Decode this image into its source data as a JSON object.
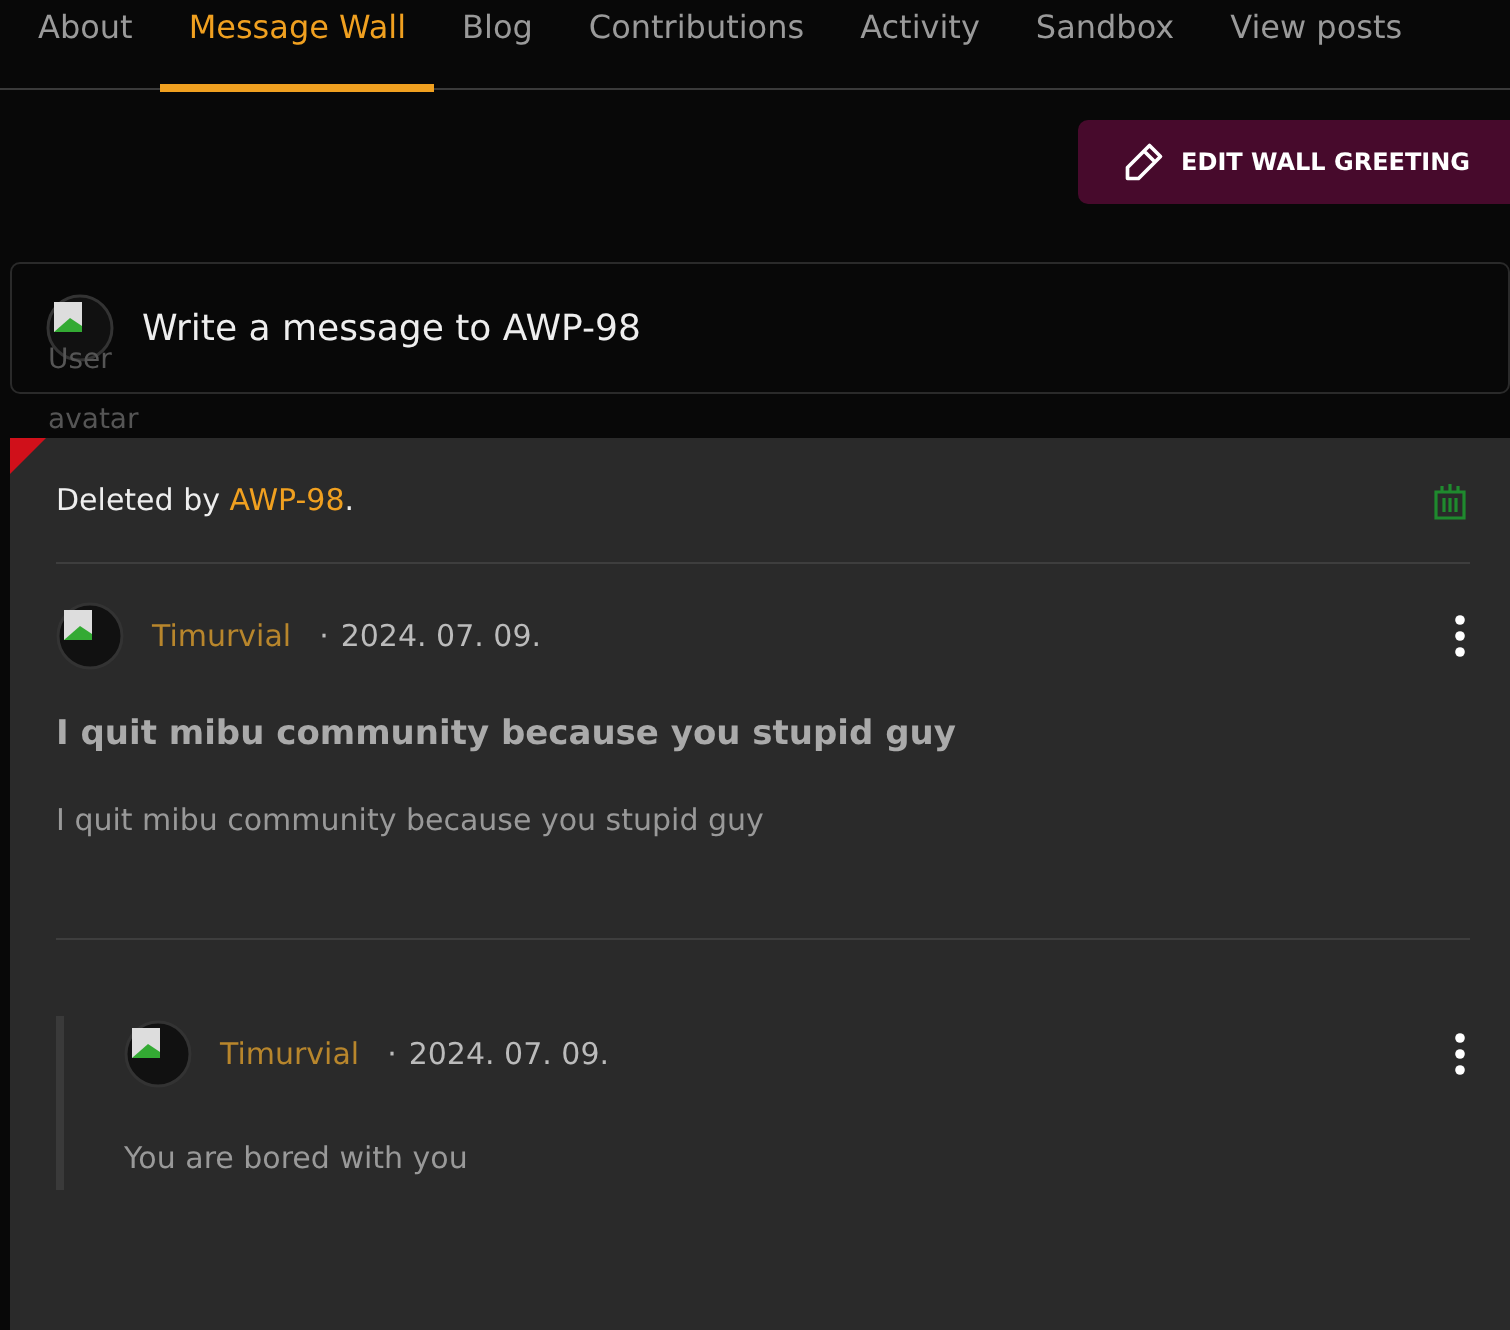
{
  "tabs": [
    {
      "label": "About",
      "selected": false
    },
    {
      "label": "Message Wall",
      "selected": true
    },
    {
      "label": "Blog",
      "selected": false
    },
    {
      "label": "Contributions",
      "selected": false
    },
    {
      "label": "Activity",
      "selected": false
    },
    {
      "label": "Sandbox",
      "selected": false
    },
    {
      "label": "View posts",
      "selected": false
    }
  ],
  "edit_button": {
    "label": "EDIT WALL GREETING"
  },
  "composer": {
    "placeholder": "Write a message to AWP-98",
    "avatar_alt": [
      "User",
      "avatar"
    ]
  },
  "thread": {
    "deleted_prefix": "Deleted by ",
    "deleted_by": "AWP-98",
    "deleted_suffix": ".",
    "post": {
      "author": "Timurvial",
      "separator": "·",
      "date": "2024. 07. 09.",
      "title": "I quit mibu community because you stupid guy",
      "body": "I quit mibu community because you stupid guy"
    },
    "replies": [
      {
        "author": "Timurvial",
        "separator": "·",
        "date": "2024. 07. 09.",
        "body": "You are bored with you"
      }
    ]
  }
}
